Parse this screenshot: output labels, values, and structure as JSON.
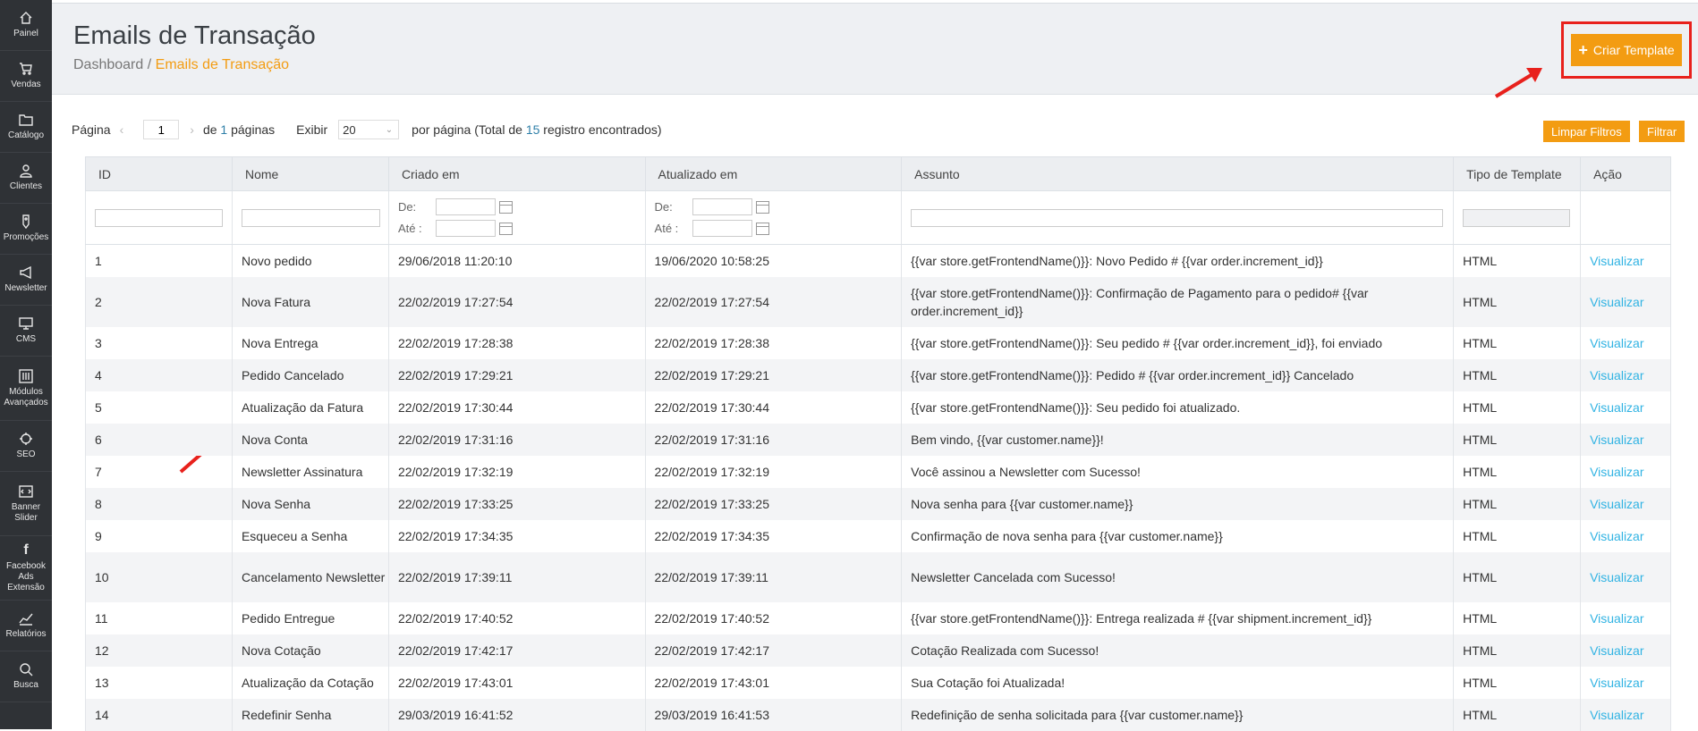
{
  "sidebar": {
    "items": [
      {
        "label": "Painel",
        "icon": "home-icon"
      },
      {
        "label": "Vendas",
        "icon": "cart-icon"
      },
      {
        "label": "Catálogo",
        "icon": "folder-icon"
      },
      {
        "label": "Clientes",
        "icon": "user-icon"
      },
      {
        "label": "Promoções",
        "icon": "tag-icon"
      },
      {
        "label": "Newsletter",
        "icon": "megaphone-icon"
      },
      {
        "label": "CMS",
        "icon": "monitor-icon"
      },
      {
        "label": "Módulos Avançados",
        "icon": "sliders-icon"
      },
      {
        "label": "SEO",
        "icon": "crosshair-icon"
      },
      {
        "label": "Banner Slider",
        "icon": "slider-icon"
      },
      {
        "label": "Facebook Ads Extensão",
        "icon": "facebook-icon"
      },
      {
        "label": "Relatórios",
        "icon": "chart-icon"
      },
      {
        "label": "Busca",
        "icon": "search-icon"
      }
    ]
  },
  "header": {
    "title": "Emails de Transação",
    "breadcrumb": {
      "home": "Dashboard",
      "sep": "/",
      "current": "Emails de Transação"
    },
    "create_button": "Criar Template"
  },
  "toolbar": {
    "page_label": "Página",
    "page_value": "1",
    "of_label": "de",
    "total_pages": "1",
    "pages_label": "páginas",
    "show_label": "Exibir",
    "per_page": "20",
    "per_page_label": "por página (Total de",
    "total_records": "15",
    "records_label": "registro encontrados)",
    "clear_filters": "Limpar Filtros",
    "filter": "Filtrar"
  },
  "filters": {
    "from_label": "De:",
    "to_label": "Até :"
  },
  "columns": [
    "ID",
    "Nome",
    "Criado em",
    "Atualizado em",
    "Assunto",
    "Tipo de Template",
    "Ação"
  ],
  "rows": [
    {
      "id": "1",
      "name": "Novo pedido",
      "created": "29/06/2018 11:20:10",
      "updated": "19/06/2020 10:58:25",
      "subject": "{{var store.getFrontendName()}}: Novo Pedido # {{var order.increment_id}}",
      "type": "HTML",
      "action": "Visualizar"
    },
    {
      "id": "2",
      "name": "Nova Fatura",
      "created": "22/02/2019 17:27:54",
      "updated": "22/02/2019 17:27:54",
      "subject": "{{var store.getFrontendName()}}: Confirmação de Pagamento para o pedido# {{var order.increment_id}}",
      "type": "HTML",
      "action": "Visualizar"
    },
    {
      "id": "3",
      "name": "Nova Entrega",
      "created": "22/02/2019 17:28:38",
      "updated": "22/02/2019 17:28:38",
      "subject": "{{var store.getFrontendName()}}: Seu pedido # {{var order.increment_id}}, foi enviado",
      "type": "HTML",
      "action": "Visualizar"
    },
    {
      "id": "4",
      "name": "Pedido Cancelado",
      "created": "22/02/2019 17:29:21",
      "updated": "22/02/2019 17:29:21",
      "subject": "{{var store.getFrontendName()}}: Pedido # {{var order.increment_id}} Cancelado",
      "type": "HTML",
      "action": "Visualizar"
    },
    {
      "id": "5",
      "name": "Atualização da Fatura",
      "created": "22/02/2019 17:30:44",
      "updated": "22/02/2019 17:30:44",
      "subject": "{{var store.getFrontendName()}}: Seu pedido foi atualizado.",
      "type": "HTML",
      "action": "Visualizar"
    },
    {
      "id": "6",
      "name": "Nova Conta",
      "created": "22/02/2019 17:31:16",
      "updated": "22/02/2019 17:31:16",
      "subject": "Bem vindo, {{var customer.name}}!",
      "type": "HTML",
      "action": "Visualizar"
    },
    {
      "id": "7",
      "name": "Newsletter Assinatura",
      "created": "22/02/2019 17:32:19",
      "updated": "22/02/2019 17:32:19",
      "subject": "Você assinou a Newsletter com Sucesso!",
      "type": "HTML",
      "action": "Visualizar"
    },
    {
      "id": "8",
      "name": "Nova Senha",
      "created": "22/02/2019 17:33:25",
      "updated": "22/02/2019 17:33:25",
      "subject": "Nova senha para {{var customer.name}}",
      "type": "HTML",
      "action": "Visualizar"
    },
    {
      "id": "9",
      "name": "Esqueceu a Senha",
      "created": "22/02/2019 17:34:35",
      "updated": "22/02/2019 17:34:35",
      "subject": "Confirmação de nova senha para {{var customer.name}}",
      "type": "HTML",
      "action": "Visualizar"
    },
    {
      "id": "10",
      "name": "Cancelamento Newsletter",
      "created": "22/02/2019 17:39:11",
      "updated": "22/02/2019 17:39:11",
      "subject": "Newsletter Cancelada com Sucesso!",
      "type": "HTML",
      "action": "Visualizar"
    },
    {
      "id": "11",
      "name": "Pedido Entregue",
      "created": "22/02/2019 17:40:52",
      "updated": "22/02/2019 17:40:52",
      "subject": "{{var store.getFrontendName()}}: Entrega realizada # {{var shipment.increment_id}}",
      "type": "HTML",
      "action": "Visualizar"
    },
    {
      "id": "12",
      "name": "Nova Cotação",
      "created": "22/02/2019 17:42:17",
      "updated": "22/02/2019 17:42:17",
      "subject": "Cotação Realizada com Sucesso!",
      "type": "HTML",
      "action": "Visualizar"
    },
    {
      "id": "13",
      "name": "Atualização da Cotação",
      "created": "22/02/2019 17:43:01",
      "updated": "22/02/2019 17:43:01",
      "subject": "Sua Cotação foi Atualizada!",
      "type": "HTML",
      "action": "Visualizar"
    },
    {
      "id": "14",
      "name": "Redefinir Senha",
      "created": "29/03/2019 16:41:52",
      "updated": "29/03/2019 16:41:53",
      "subject": "Redefinição de senha solicitada para {{var customer.name}}",
      "type": "HTML",
      "action": "Visualizar"
    }
  ],
  "colors": {
    "accent": "#f39c12",
    "link": "#31b3e3",
    "sidebar": "#2f3236",
    "highlight": "#e8211c"
  }
}
